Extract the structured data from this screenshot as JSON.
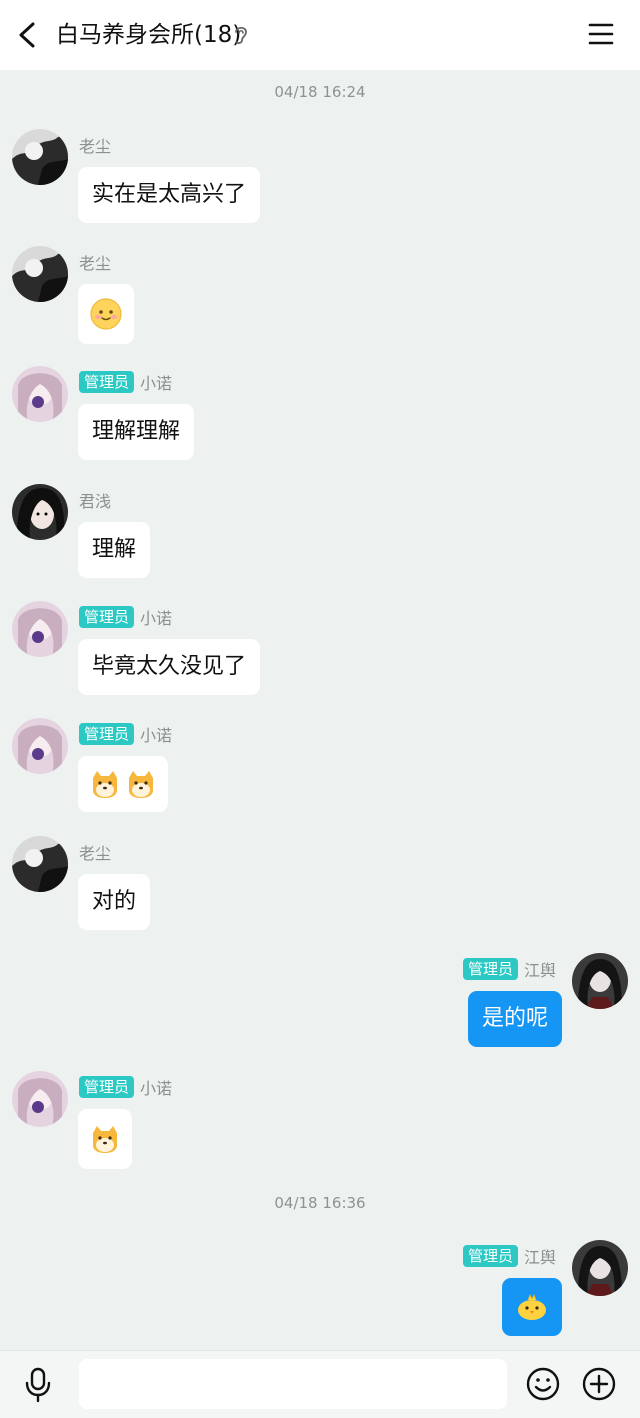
{
  "header": {
    "title": "白马养身会所(18)"
  },
  "timestamps": [
    "04/18 16:24",
    "04/18 16:36"
  ],
  "badge_label": "管理员",
  "messages": [
    {
      "sender": "老尘",
      "text": "实在是太高兴了"
    },
    {
      "sender": "老尘",
      "emoji": "smile-face-emoji"
    },
    {
      "sender": "小诺",
      "text": "理解理解"
    },
    {
      "sender": "君浅",
      "text": "理解"
    },
    {
      "sender": "小诺",
      "text": "毕竟太久没见了"
    },
    {
      "sender": "小诺",
      "emoji": "doge-face-emoji x2"
    },
    {
      "sender": "老尘",
      "text": "对的"
    },
    {
      "sender": "江舆",
      "text": "是的呢"
    },
    {
      "sender": "小诺",
      "emoji": "doge-face-emoji"
    },
    {
      "sender": "江舆",
      "emoji": "chick-emoji"
    }
  ],
  "input": {
    "placeholder": ""
  },
  "colors": {
    "accent": "#1596f5",
    "badge": "#2cc9c4",
    "background": "#edf1ef"
  }
}
